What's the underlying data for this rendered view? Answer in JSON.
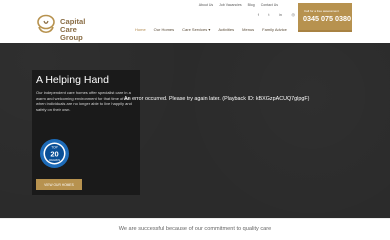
{
  "topbar": {
    "links": [
      "About Us",
      "Job Vacancies",
      "Blog",
      "Contact Us"
    ],
    "social_icons": [
      "facebook-icon",
      "twitter-icon",
      "linkedin-icon",
      "instagram-icon"
    ]
  },
  "logo": {
    "line1": "Capital Care",
    "line2": "Group"
  },
  "nav": {
    "items": [
      {
        "label": "Home"
      },
      {
        "label": "Our Homes"
      },
      {
        "label": "Care Services ▾"
      },
      {
        "label": "Activities"
      },
      {
        "label": "Menus"
      },
      {
        "label": "Family Advice"
      }
    ]
  },
  "phone": {
    "label": "Call for a free assessment",
    "number": "0345 075 0380"
  },
  "hero": {
    "title": "A Helping Hand",
    "description": "Our independent care homes offer specialist care in a warm and welcoming environment for that time of life when individuals are no longer able to live happily and safely on their own.",
    "error": "An error occurred. Please try again later. (Playback ID: kBXGzpACUQ7glpgF)",
    "button": "VIEW OUR HOMES",
    "badge": {
      "top": "TOP",
      "number": "20",
      "sub": "AWARDS"
    }
  },
  "colors": {
    "accent": "#b7924f",
    "dark": "#2b2b2b"
  },
  "tagline": "We are successful because of our commitment to quality care"
}
